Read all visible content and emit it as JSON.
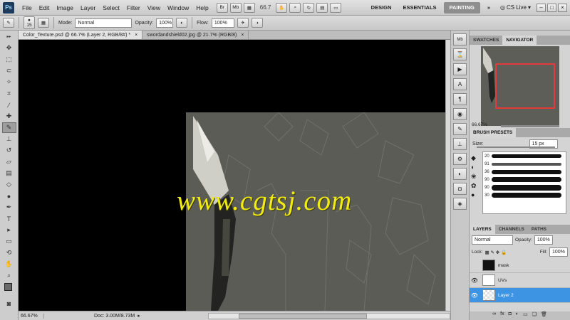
{
  "menubar": {
    "logo": "Ps",
    "menus": [
      "File",
      "Edit",
      "Image",
      "Layer",
      "Select",
      "Filter",
      "View",
      "Window",
      "Help"
    ],
    "br_label": "Br",
    "mb_label": "Mb",
    "zoom": "66.7",
    "workspaces": [
      "DESIGN",
      "ESSENTIALS",
      "PAINTING"
    ],
    "active_workspace": "PAINTING",
    "more": "»",
    "cslive": "CS Live"
  },
  "options": {
    "brush_size": "15",
    "mode_label": "Mode:",
    "mode_value": "Normal",
    "opacity_label": "Opacity:",
    "opacity_value": "100%",
    "flow_label": "Flow:",
    "flow_value": "100%"
  },
  "documents": {
    "tabs": [
      {
        "title": "Color_Texture.psd @ 66.7% (Layer 2, RGB/8#) *",
        "close": "×"
      },
      {
        "title": "swordandshield02.jpg @ 21.7% (RGB/8)",
        "close": "×"
      }
    ]
  },
  "canvas": {
    "watermark": "www.cgtsj.com",
    "bg_color": "#000000",
    "doc_color": "#5a5c55"
  },
  "status": {
    "zoom": "66.67%",
    "doc": "Doc: 3.00M/8.73M"
  },
  "navigator": {
    "tabs": [
      "SWATCHES",
      "NAVIGATOR"
    ],
    "active": "NAVIGATOR",
    "zoom": "66.67%"
  },
  "brush_presets": {
    "title": "BRUSH PRESETS",
    "size_label": "Size:",
    "size_value": "15 px",
    "sizes": [
      "20",
      "91",
      "36",
      "90",
      "90",
      "30"
    ]
  },
  "layers": {
    "tabs": [
      "LAYERS",
      "CHANNELS",
      "PATHS"
    ],
    "active": "LAYERS",
    "blend": "Normal",
    "opacity_label": "Opacity:",
    "opacity_value": "100%",
    "lock_label": "Lock:",
    "fill_label": "Fill:",
    "fill_value": "100%",
    "items": [
      {
        "name": "mask"
      },
      {
        "name": "UVs"
      },
      {
        "name": "Layer 2"
      }
    ],
    "selected": "Layer 2"
  }
}
